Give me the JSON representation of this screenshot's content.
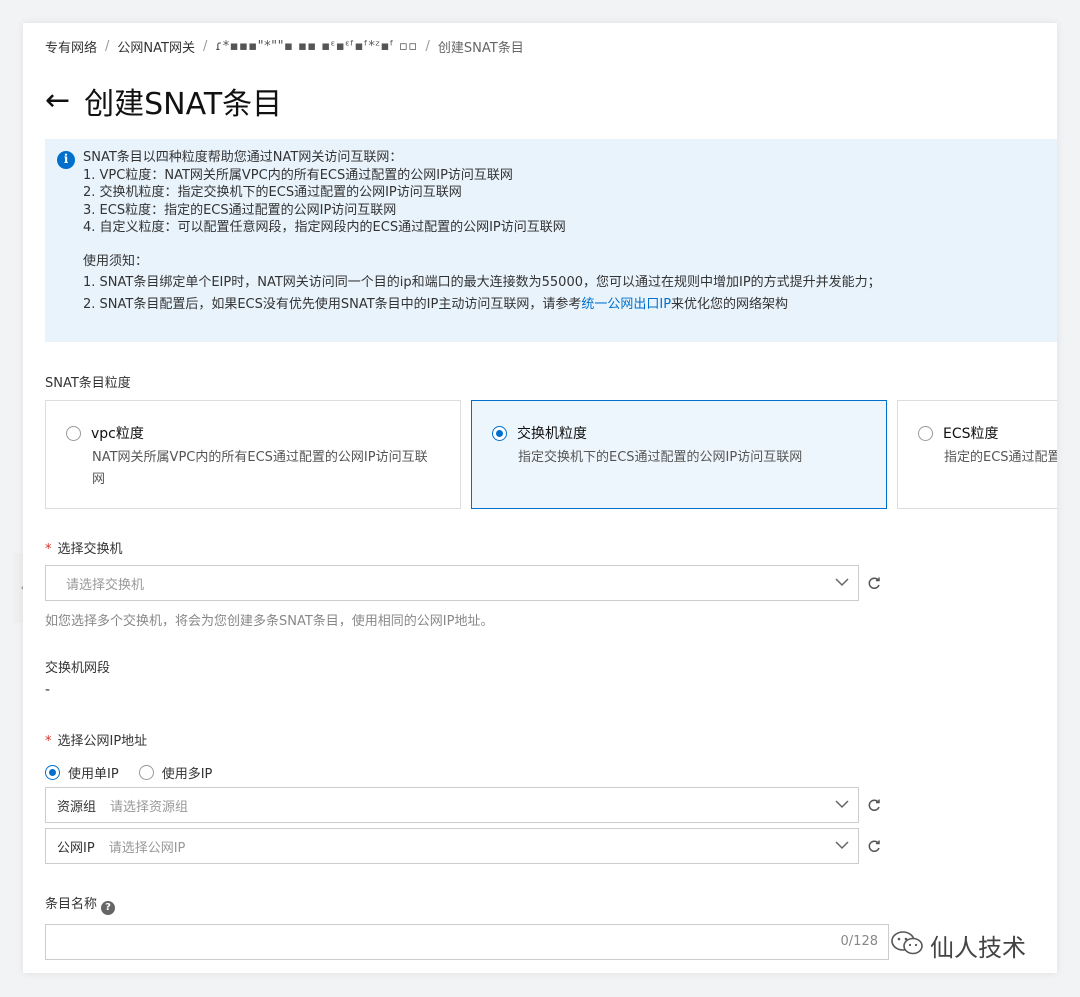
{
  "breadcrumb": {
    "items": [
      "专有网络",
      "公网NAT网关",
      "ɾ*▪▪▪\"*\"\"▪ ▪▪ ▪ᵋ▪ᵋᶠ▪ᶠ*ᶻ▪ᶠ ▫▫",
      "创建SNAT条目"
    ]
  },
  "page": {
    "back": "←",
    "title": "创建SNAT条目"
  },
  "notice": {
    "icon": "info-icon",
    "lines": [
      "SNAT条目以四种粒度帮助您通过NAT网关访问互联网：",
      "1. VPC粒度：NAT网关所属VPC内的所有ECS通过配置的公网IP访问互联网",
      "2. 交换机粒度：指定交换机下的ECS通过配置的公网IP访问互联网",
      "3. ECS粒度：指定的ECS通过配置的公网IP访问互联网",
      "4. 自定义粒度：可以配置任意网段，指定网段内的ECS通过配置的公网IP访问互联网"
    ],
    "notes_title": "使用须知：",
    "note1": "1. SNAT条目绑定单个EIP时，NAT网关访问同一个目的ip和端口的最大连接数为55000，您可以通过在规则中增加IP的方式提升并发能力；",
    "note2_prefix": "2. SNAT条目配置后，如果ECS没有优先使用SNAT条目中的IP主动访问互联网，请参考",
    "note2_link": "统一公网出口IP",
    "note2_suffix": "来优化您的网络架构"
  },
  "granularity": {
    "label": "SNAT条目粒度",
    "cards": [
      {
        "title": "vpc粒度",
        "desc": "NAT网关所属VPC内的所有ECS通过配置的公网IP访问互联网",
        "selected": false
      },
      {
        "title": "交换机粒度",
        "desc": "指定交换机下的ECS通过配置的公网IP访问互联网",
        "selected": true
      },
      {
        "title": "ECS粒度",
        "desc": "指定的ECS通过配置的公网IP访问互联网",
        "selected": false
      }
    ]
  },
  "vswitch": {
    "label": "选择交换机",
    "required_mark": "*",
    "placeholder": "请选择交换机",
    "hint": "如您选择多个交换机，将会为您创建多条SNAT条目，使用相同的公网IP地址。"
  },
  "vswitch_cidr": {
    "label": "交换机网段",
    "value": "-"
  },
  "public_ip": {
    "label": "选择公网IP地址",
    "required_mark": "*",
    "single_ip": "使用单IP",
    "multi_ip": "使用多IP",
    "selected_mode": "single",
    "resource_group_prefix": "资源组",
    "resource_group_placeholder": "请选择资源组",
    "ip_prefix": "公网IP",
    "ip_placeholder": "请选择公网IP"
  },
  "entry_name": {
    "label": "条目名称",
    "help": "?",
    "counter": "0/128"
  },
  "icons": {
    "chevron": "chevron-down-icon",
    "refresh": "refresh-icon",
    "collapse": "chevron-left-icon"
  },
  "watermark": {
    "text": "仙人技术"
  },
  "colors": {
    "accent": "#0070cc",
    "notice_bg": "#e8f3fc",
    "required": "#d93026"
  }
}
